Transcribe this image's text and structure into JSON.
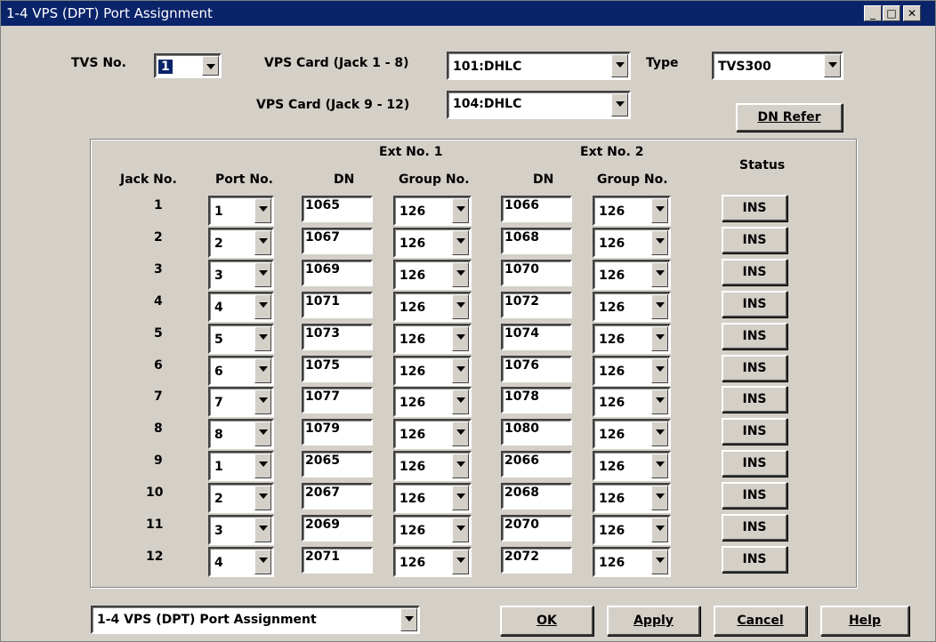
{
  "window": {
    "title": "1-4 VPS (DPT) Port Assignment"
  },
  "titlebar_buttons": [
    "_",
    "□",
    "✕"
  ],
  "top": {
    "tvs_label": "TVS No.",
    "tvs_value": "1",
    "vps1_label": "VPS Card (Jack 1 - 8)",
    "vps1_value": "101:DHLC",
    "type_label": "Type",
    "type_value": "TVS300",
    "vps2_label": "VPS Card (Jack 9 - 12)",
    "vps2_value": "104:DHLC",
    "dn_refer": "DN Refer"
  },
  "headers": {
    "ext1": "Ext No. 1",
    "ext2": "Ext No. 2",
    "jack": "Jack No.",
    "port": "Port No.",
    "dn1": "DN",
    "group1": "Group No.",
    "dn2": "DN",
    "group2": "Group No.",
    "status": "Status"
  },
  "rows": [
    {
      "jack": "1",
      "port": "1",
      "dn1": "1065",
      "group1": "126",
      "dn2": "1066",
      "group2": "126",
      "status": "INS"
    },
    {
      "jack": "2",
      "port": "2",
      "dn1": "1067",
      "group1": "126",
      "dn2": "1068",
      "group2": "126",
      "status": "INS"
    },
    {
      "jack": "3",
      "port": "3",
      "dn1": "1069",
      "group1": "126",
      "dn2": "1070",
      "group2": "126",
      "status": "INS"
    },
    {
      "jack": "4",
      "port": "4",
      "dn1": "1071",
      "group1": "126",
      "dn2": "1072",
      "group2": "126",
      "status": "INS"
    },
    {
      "jack": "5",
      "port": "5",
      "dn1": "1073",
      "group1": "126",
      "dn2": "1074",
      "group2": "126",
      "status": "INS"
    },
    {
      "jack": "6",
      "port": "6",
      "dn1": "1075",
      "group1": "126",
      "dn2": "1076",
      "group2": "126",
      "status": "INS"
    },
    {
      "jack": "7",
      "port": "7",
      "dn1": "1077",
      "group1": "126",
      "dn2": "1078",
      "group2": "126",
      "status": "INS"
    },
    {
      "jack": "8",
      "port": "8",
      "dn1": "1079",
      "group1": "126",
      "dn2": "1080",
      "group2": "126",
      "status": "INS"
    },
    {
      "jack": "9",
      "port": "1",
      "dn1": "2065",
      "group1": "126",
      "dn2": "2066",
      "group2": "126",
      "status": "INS"
    },
    {
      "jack": "10",
      "port": "2",
      "dn1": "2067",
      "group1": "126",
      "dn2": "2068",
      "group2": "126",
      "status": "INS"
    },
    {
      "jack": "11",
      "port": "3",
      "dn1": "2069",
      "group1": "126",
      "dn2": "2070",
      "group2": "126",
      "status": "INS"
    },
    {
      "jack": "12",
      "port": "4",
      "dn1": "2071",
      "group1": "126",
      "dn2": "2072",
      "group2": "126",
      "status": "INS"
    }
  ],
  "bottom": {
    "screen_select": "1-4 VPS (DPT) Port Assignment",
    "ok": "OK",
    "apply": "Apply",
    "cancel": "Cancel",
    "help": "Help"
  },
  "colors": {
    "titlebar": "#0a246a",
    "face": "#d4d0c8"
  }
}
